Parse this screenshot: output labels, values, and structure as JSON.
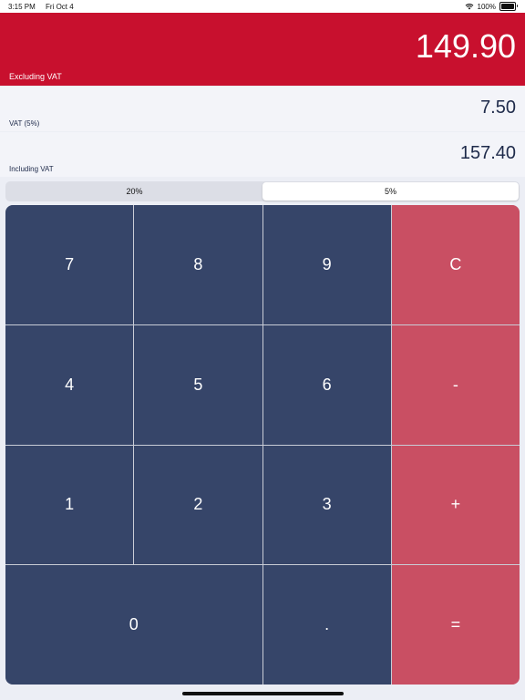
{
  "status_bar": {
    "time": "3:15 PM",
    "date": "Fri Oct 4",
    "battery": "100%"
  },
  "excluding": {
    "value": "149.90",
    "label": "Excluding VAT"
  },
  "vat": {
    "value": "7.50",
    "label": "VAT (5%)"
  },
  "including": {
    "value": "157.40",
    "label": "Including VAT"
  },
  "rates": {
    "options": [
      "20%",
      "5%"
    ],
    "selected": "5%"
  },
  "keypad": {
    "k7": "7",
    "k8": "8",
    "k9": "9",
    "clear": "C",
    "k4": "4",
    "k5": "5",
    "k6": "6",
    "minus": "-",
    "k1": "1",
    "k2": "2",
    "k3": "3",
    "plus": "+",
    "k0": "0",
    "dot": ".",
    "equals": "="
  },
  "colors": {
    "header": "#c8102e",
    "number_key": "#364569",
    "operator_key": "#c94f63"
  }
}
